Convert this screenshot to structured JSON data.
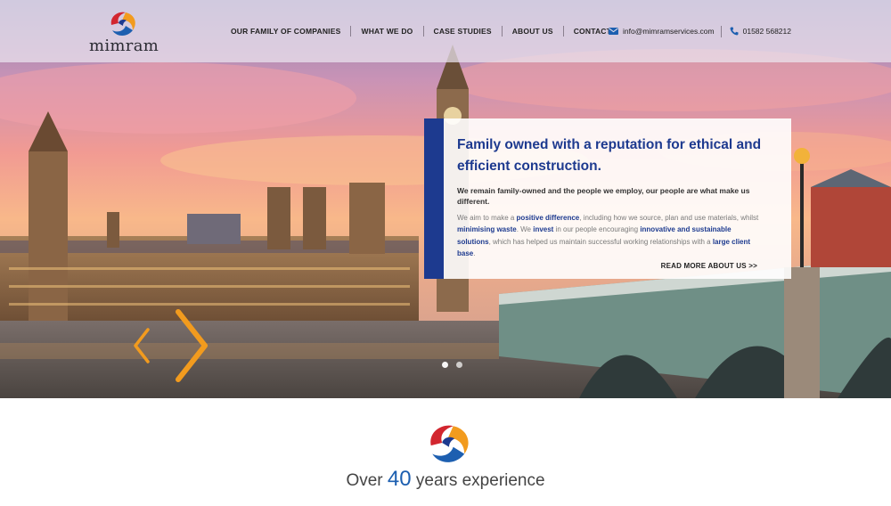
{
  "brand": {
    "name": "mimram",
    "colors": {
      "navy": "#1d3a8f",
      "orange": "#f29b1e",
      "red": "#d2262f",
      "blue": "#1d5fb0"
    }
  },
  "nav": {
    "items": [
      {
        "label": "OUR FAMILY OF COMPANIES"
      },
      {
        "label": "WHAT WE DO"
      },
      {
        "label": "CASE STUDIES"
      },
      {
        "label": "ABOUT US"
      },
      {
        "label": "CONTACT"
      }
    ]
  },
  "contact": {
    "email": "info@mimramservices.com",
    "email_icon": "envelope-icon",
    "phone": "01582 568212",
    "phone_icon": "phone-icon"
  },
  "hero": {
    "title": "Family owned with a reputation for ethical and efficient construction.",
    "lead": "We remain family-owned and the people we employ, our people are what make us different.",
    "body": {
      "p1": "We aim to make a ",
      "b1": "positive difference",
      "p2": ", including how we source, plan and use materials, whilst ",
      "b2": "minimising waste",
      "p3": ". We ",
      "b3": "invest",
      "p4": " in our people encouraging ",
      "b4": "innovative and sustainable solutions",
      "p5": ", which has helped us maintain successful working relationships with a ",
      "b5": "large client base",
      "p6": "."
    },
    "read_more": "READ MORE ABOUT US >>",
    "slider": {
      "prev_icon": "chevron-left-icon",
      "next_icon": "chevron-right-icon",
      "slides": 2,
      "active": 1
    }
  },
  "experience": {
    "prefix": "Over ",
    "number": "40",
    "suffix": " years experience"
  }
}
